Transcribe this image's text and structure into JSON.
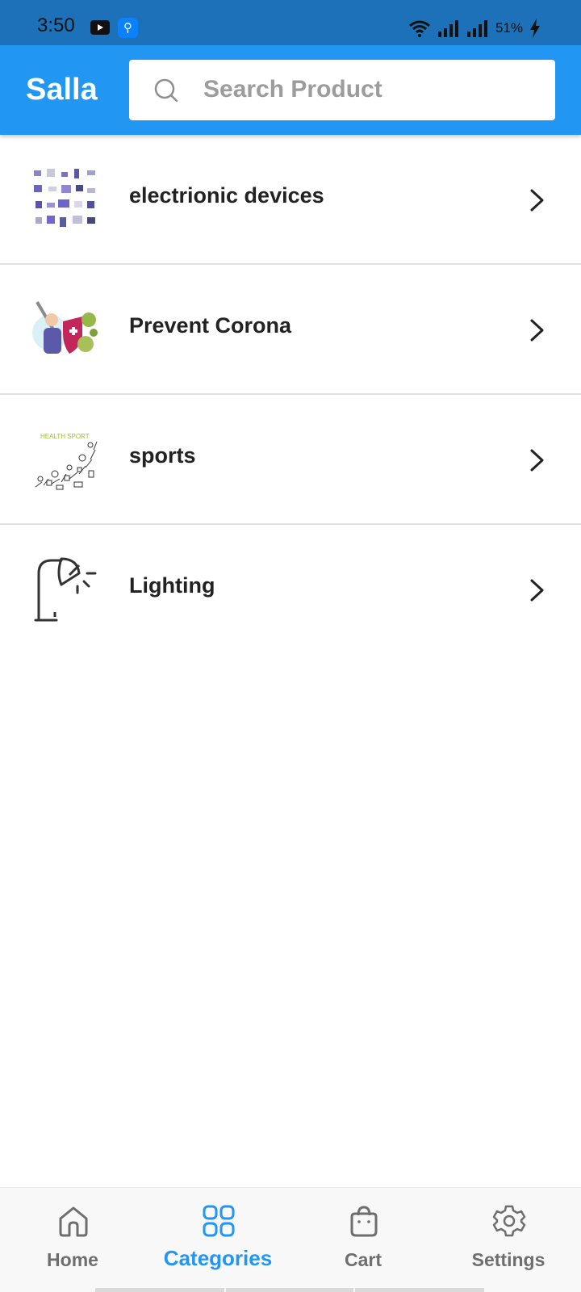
{
  "status_bar": {
    "time": "3:50",
    "battery": "51%"
  },
  "header": {
    "title": "Salla",
    "search": {
      "placeholder": "Search Product"
    }
  },
  "categories": [
    {
      "label": "electrionic devices",
      "icon": "electronic-devices-thumbnail"
    },
    {
      "label": "Prevent Corona",
      "icon": "prevent-corona-thumbnail"
    },
    {
      "label": "sports",
      "icon": "sports-thumbnail",
      "image_text": "HEALTH SPORT"
    },
    {
      "label": "Lighting",
      "icon": "lamp-thumbnail"
    }
  ],
  "bottom_nav": {
    "active": "Categories",
    "items": [
      {
        "label": "Home",
        "icon": "home-icon"
      },
      {
        "label": "Categories",
        "icon": "categories-icon"
      },
      {
        "label": "Cart",
        "icon": "cart-icon"
      },
      {
        "label": "Settings",
        "icon": "settings-icon"
      }
    ]
  },
  "colors": {
    "status_bar": "#1c71b8",
    "header": "#2196f3",
    "active_nav": "#2196f3",
    "inactive_nav": "#6e6e6e"
  }
}
